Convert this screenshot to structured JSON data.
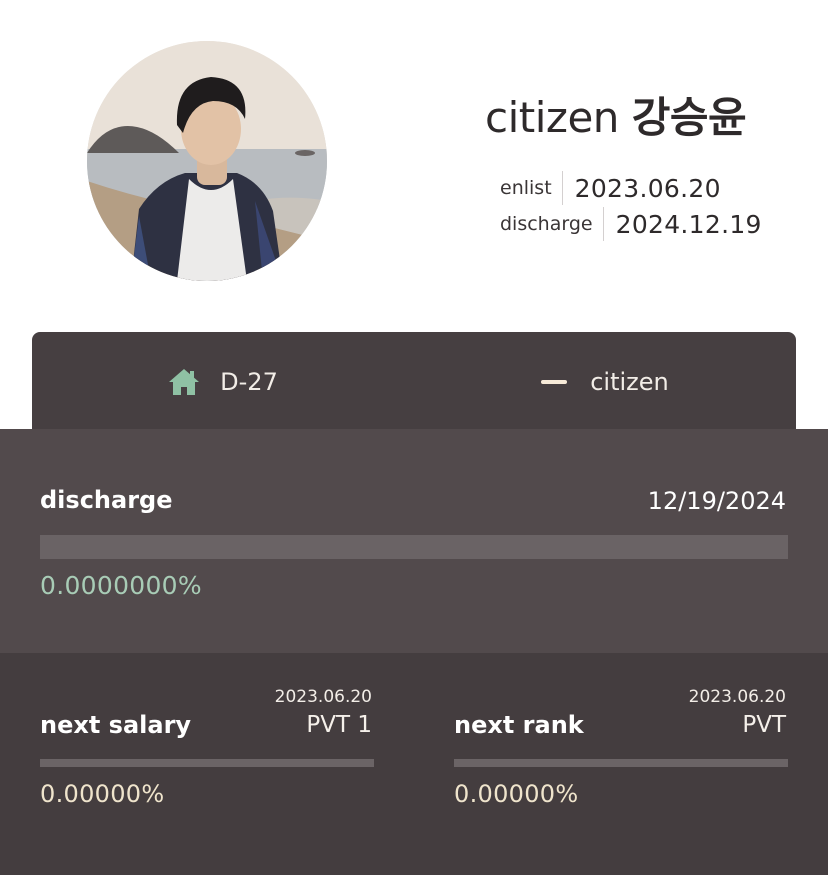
{
  "profile": {
    "rank_prefix": "citizen",
    "name": "강승윤",
    "enlist_label": "enlist",
    "enlist_date": "2023.06.20",
    "discharge_label": "discharge",
    "discharge_date": "2024.12.19"
  },
  "tabs": [
    {
      "icon": "home-icon",
      "label": "D-27",
      "icon_color": "#8fc1a4"
    },
    {
      "icon": "dash-icon",
      "label": "citizen",
      "icon_color": "#f7ead8"
    }
  ],
  "discharge": {
    "title": "discharge",
    "date": "12/19/2024",
    "percent_text": "0.0000000%",
    "progress_fraction": 0
  },
  "next_salary": {
    "date": "2023.06.20",
    "title": "next salary",
    "value": "PVT 1",
    "percent_text": "0.00000%",
    "progress_fraction": 0
  },
  "next_rank": {
    "date": "2023.06.20",
    "title": "next rank",
    "value": "PVT",
    "percent_text": "0.00000%",
    "progress_fraction": 0
  },
  "colors": {
    "accent_green": "#8fc1a4",
    "accent_cream": "#efe2c8",
    "panel_dark": "#443d3f",
    "panel_mid": "#524a4c"
  }
}
